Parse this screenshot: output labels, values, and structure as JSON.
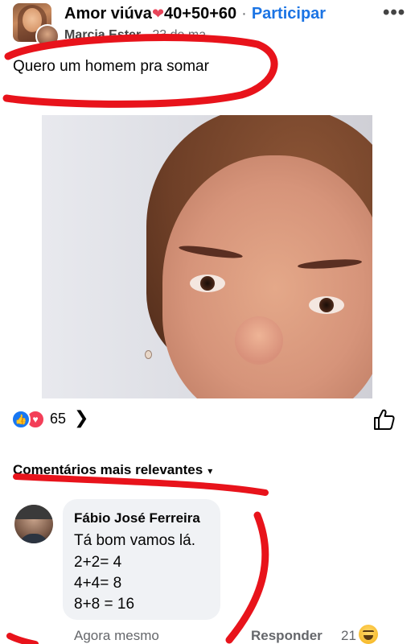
{
  "header": {
    "group_name": "Amor viúva",
    "heart_icon": "heart-icon",
    "group_suffix": "40+50+60",
    "separator": "·",
    "join_label": "Participar",
    "more_label": "•••",
    "author": "Marcia Ester",
    "date": "23 de ma..."
  },
  "post": {
    "text": "Quero um homem pra somar"
  },
  "reactions": {
    "like_glyph": "👍",
    "love_glyph": "♥",
    "count": "65",
    "chevron": "❯"
  },
  "comments": {
    "header_label": "Comentários mais relevantes",
    "caret": "▾",
    "items": [
      {
        "name": "Fábio José Ferreira",
        "lines": [
          "Tá bom vamos lá.",
          "2+2= 4",
          "4+4= 8",
          "8+8 = 16"
        ],
        "time": "Agora mesmo",
        "reply_label": "Responder",
        "reaction_count": "21",
        "reaction_icon": "laugh-emoji-icon"
      }
    ]
  },
  "colors": {
    "annotation_red": "#e8131b",
    "link_blue": "#1b74e4",
    "like_blue": "#1877f2",
    "love_red": "#f33e58",
    "meta_gray": "#65676b"
  }
}
